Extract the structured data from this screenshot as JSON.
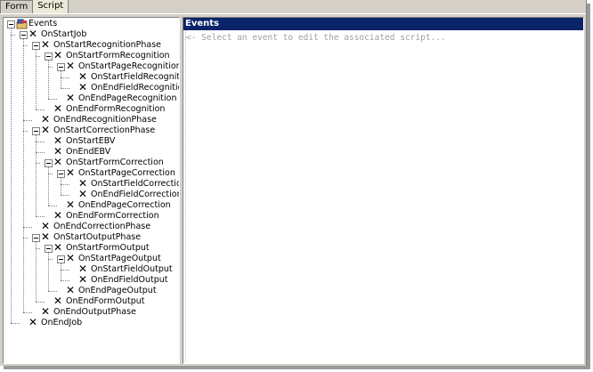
{
  "tabs": [
    {
      "label": "Form",
      "active": false
    },
    {
      "label": "Script",
      "active": true
    }
  ],
  "script_panel": {
    "header": "Events",
    "placeholder": "<- Select an event to edit the associated script..."
  },
  "tree": [
    {
      "label": "Events",
      "depth": 0,
      "icon": "events-folder-icon",
      "expander": true
    },
    {
      "label": "OnStartJob",
      "depth": 1,
      "icon": "event-x-icon",
      "expander": true
    },
    {
      "label": "OnStartRecognitionPhase",
      "depth": 2,
      "icon": "event-x-icon",
      "expander": true
    },
    {
      "label": "OnStartFormRecognition",
      "depth": 3,
      "icon": "event-x-icon",
      "expander": true
    },
    {
      "label": "OnStartPageRecognition",
      "depth": 4,
      "icon": "event-x-icon",
      "expander": true
    },
    {
      "label": "OnStartFieldRecognition",
      "depth": 5,
      "icon": "event-x-icon",
      "expander": false
    },
    {
      "label": "OnEndFieldRecognition",
      "depth": 5,
      "icon": "event-x-icon",
      "expander": false
    },
    {
      "label": "OnEndPageRecognition",
      "depth": 4,
      "icon": "event-x-icon",
      "expander": false
    },
    {
      "label": "OnEndFormRecognition",
      "depth": 3,
      "icon": "event-x-icon",
      "expander": false
    },
    {
      "label": "OnEndRecognitionPhase",
      "depth": 2,
      "icon": "event-x-icon",
      "expander": false
    },
    {
      "label": "OnStartCorrectionPhase",
      "depth": 2,
      "icon": "event-x-icon",
      "expander": true
    },
    {
      "label": "OnStartEBV",
      "depth": 3,
      "icon": "event-x-icon",
      "expander": false
    },
    {
      "label": "OnEndEBV",
      "depth": 3,
      "icon": "event-x-icon",
      "expander": false
    },
    {
      "label": "OnStartFormCorrection",
      "depth": 3,
      "icon": "event-x-icon",
      "expander": true
    },
    {
      "label": "OnStartPageCorrection",
      "depth": 4,
      "icon": "event-x-icon",
      "expander": true
    },
    {
      "label": "OnStartFieldCorrection",
      "depth": 5,
      "icon": "event-x-icon",
      "expander": false
    },
    {
      "label": "OnEndFieldCorrection",
      "depth": 5,
      "icon": "event-x-icon",
      "expander": false
    },
    {
      "label": "OnEndPageCorrection",
      "depth": 4,
      "icon": "event-x-icon",
      "expander": false
    },
    {
      "label": "OnEndFormCorrection",
      "depth": 3,
      "icon": "event-x-icon",
      "expander": false
    },
    {
      "label": "OnEndCorrectionPhase",
      "depth": 2,
      "icon": "event-x-icon",
      "expander": false
    },
    {
      "label": "OnStartOutputPhase",
      "depth": 2,
      "icon": "event-x-icon",
      "expander": true
    },
    {
      "label": "OnStartFormOutput",
      "depth": 3,
      "icon": "event-x-icon",
      "expander": true
    },
    {
      "label": "OnStartPageOutput",
      "depth": 4,
      "icon": "event-x-icon",
      "expander": true
    },
    {
      "label": "OnStartFieldOutput",
      "depth": 5,
      "icon": "event-x-icon",
      "expander": false
    },
    {
      "label": "OnEndFieldOutput",
      "depth": 5,
      "icon": "event-x-icon",
      "expander": false
    },
    {
      "label": "OnEndPageOutput",
      "depth": 4,
      "icon": "event-x-icon",
      "expander": false
    },
    {
      "label": "OnEndFormOutput",
      "depth": 3,
      "icon": "event-x-icon",
      "expander": false
    },
    {
      "label": "OnEndOutputPhase",
      "depth": 2,
      "icon": "event-x-icon",
      "expander": false
    },
    {
      "label": "OnEndJob",
      "depth": 1,
      "icon": "event-x-icon",
      "expander": false
    }
  ],
  "colors": {
    "header_bg": "#0a246a",
    "face": "#d4d0c8",
    "placeholder_text": "#a0a0a0"
  }
}
